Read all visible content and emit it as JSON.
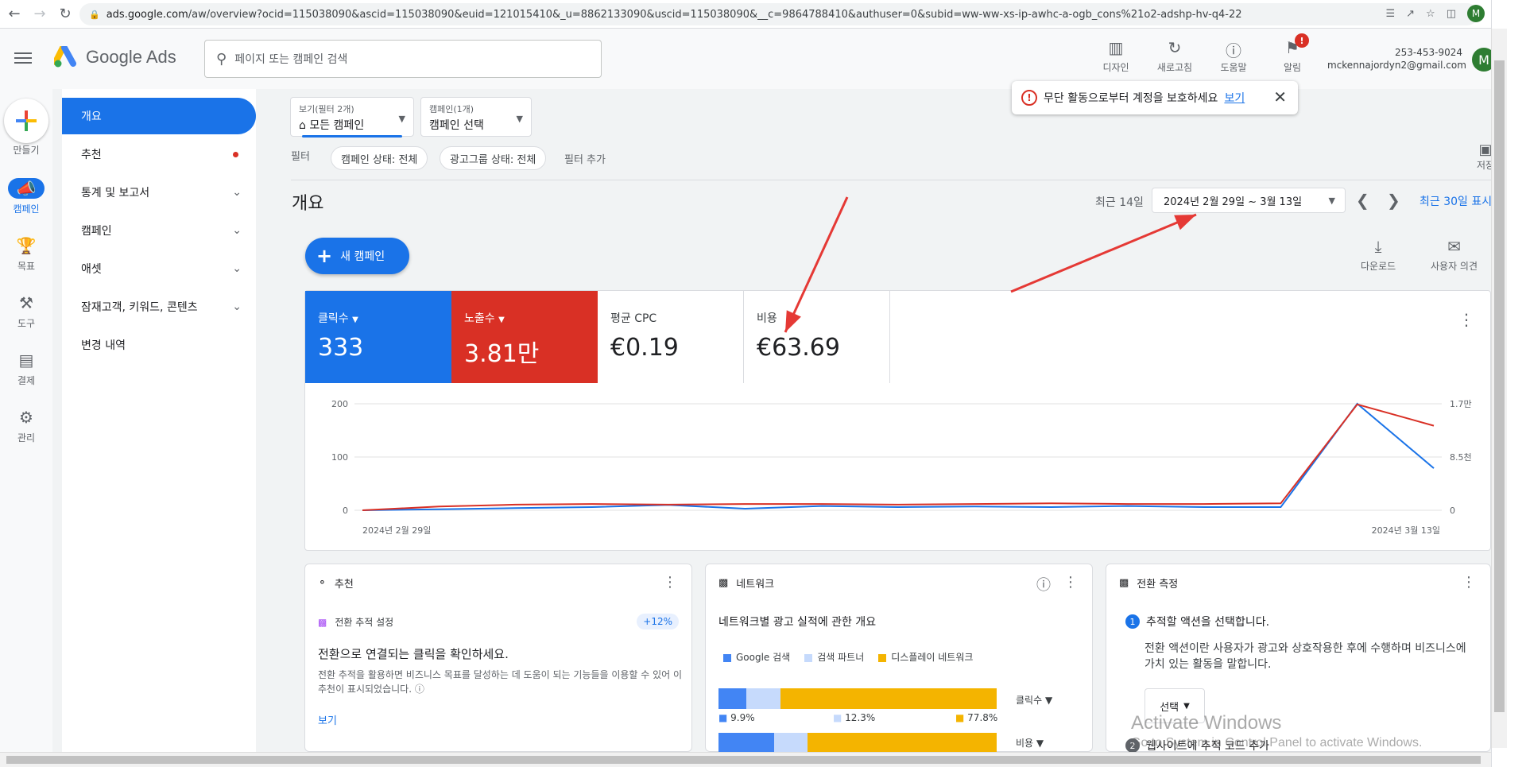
{
  "browser": {
    "url_host": "ads.google.com",
    "url_path": "/aw/overview?ocid=115038090&ascid=115038090&euid=121015410&_u=8862133090&uscid=115038090&__c=9864788410&authuser=0&subid=ww-ww-xs-ip-awhc-a-ogb_cons%21o2-adshp-hv-q4-22",
    "profile_initial": "M"
  },
  "header": {
    "logo_text": "Google Ads",
    "search_placeholder": "페이지 또는 캠페인 검색",
    "tools": [
      {
        "label": "디자인",
        "icon": "design-icon"
      },
      {
        "label": "새로고침",
        "icon": "refresh-icon"
      },
      {
        "label": "도움말",
        "icon": "help-icon"
      },
      {
        "label": "알림",
        "icon": "bell-icon",
        "badge": "!"
      }
    ],
    "account_phone": "253-453-9024",
    "account_email": "mckennajordyn2@gmail.com",
    "account_initial": "M"
  },
  "rail": {
    "create_label": "만들기",
    "items": [
      {
        "label": "캠페인",
        "icon": "megaphone-icon",
        "active": true
      },
      {
        "label": "목표",
        "icon": "trophy-icon"
      },
      {
        "label": "도구",
        "icon": "tools-icon"
      },
      {
        "label": "결제",
        "icon": "card-icon"
      },
      {
        "label": "관리",
        "icon": "gear-icon"
      }
    ]
  },
  "nav": {
    "items": [
      {
        "label": "개요",
        "active": true
      },
      {
        "label": "추천",
        "dot": true
      },
      {
        "label": "통계 및 보고서",
        "expand": true
      },
      {
        "label": "캠페인",
        "expand": true
      },
      {
        "label": "애셋",
        "expand": true
      },
      {
        "label": "잠재고객, 키워드, 콘텐츠",
        "expand": true
      },
      {
        "label": "변경 내역"
      }
    ]
  },
  "filters": {
    "view_small": "보기(필터 2개)",
    "view_value": "모든 캠페인",
    "campaign_small": "캠페인(1개)",
    "campaign_value": "캠페인 선택",
    "filter_label": "필터",
    "chips": [
      "캠페인 상태: 전체",
      "광고그룹 상태: 전체"
    ],
    "add_filter": "필터 추가"
  },
  "alert": {
    "text": "무단 활동으로부터 계정을 보호하세요",
    "link": "보기"
  },
  "save_label": "저장",
  "overview": {
    "title": "개요",
    "date_label": "최근 14일",
    "date_range": "2024년 2월 29일 ~ 3월 13일",
    "recent30": "최근 30일 표시",
    "new_campaign": "새 캠페인",
    "download": "다운로드",
    "feedback": "사용자 의견"
  },
  "metrics": [
    {
      "label": "클릭수",
      "value": "333",
      "style": "blue",
      "dropdown": true
    },
    {
      "label": "노출수",
      "value": "3.81만",
      "style": "red",
      "dropdown": true
    },
    {
      "label": "평균 CPC",
      "value": "€0.19",
      "style": "plain"
    },
    {
      "label": "비용",
      "value": "€63.69",
      "style": "plain"
    }
  ],
  "chart_data": {
    "type": "line",
    "x_start_label": "2024년 2월 29일",
    "x_end_label": "2024년 3월 13일",
    "y_left_ticks": [
      "200",
      "100",
      "0"
    ],
    "y_right_ticks": [
      "1.7만",
      "8.5천",
      "0"
    ],
    "ylim_left": [
      0,
      200
    ],
    "ylim_right": [
      0,
      17000
    ],
    "series": [
      {
        "color": "#1a73e8",
        "axis": "left",
        "values": [
          0,
          2,
          4,
          6,
          10,
          3,
          8,
          6,
          7,
          6,
          8,
          6,
          6,
          200,
          79
        ]
      },
      {
        "color": "#d93025",
        "axis": "right",
        "values": [
          0,
          600,
          900,
          1000,
          900,
          1000,
          1000,
          900,
          1000,
          1100,
          1000,
          1000,
          1100,
          16900,
          13500
        ]
      }
    ]
  },
  "cards": {
    "rec": {
      "title": "추천",
      "sub": "전환 추적 설정",
      "badge": "+12%",
      "headline": "전환으로 연결되는 클릭을 확인하세요.",
      "desc": "전환 추적을 활용하면 비즈니스 목표를 달성하는 데 도움이 되는 기능들을 이용할 수 있어 이 추천이 표시되었습니다.",
      "link": "보기"
    },
    "network": {
      "title": "네트워크",
      "subtitle": "네트워크별 광고 실적에 관한 개요",
      "legend": [
        {
          "name": "Google 검색",
          "color": "#4285f4"
        },
        {
          "name": "검색 파트너",
          "color": "#c6dafc"
        },
        {
          "name": "디스플레이 네트워크",
          "color": "#f4b400"
        }
      ],
      "rows": [
        {
          "metric": "클릭수",
          "pct": [
            9.9,
            12.3,
            77.8
          ],
          "labels": [
            "9.9%",
            "12.3%",
            "77.8%"
          ]
        },
        {
          "metric": "비용",
          "pct": [
            20,
            12,
            68
          ]
        }
      ]
    },
    "conversion": {
      "title": "전환 측정",
      "step1_num": "1",
      "step1": "추적할 액션을 선택합니다.",
      "desc": "전환 액션이란 사용자가 광고와 상호작용한 후에 수행하며 비즈니스에 가치 있는 활동을 말합니다.",
      "select": "선택",
      "step2_num": "2",
      "step2": "웹사이트에 추적 코드 추가"
    }
  },
  "watermark": {
    "line1": "Activate Windows",
    "line2": "Go to System in Control Panel to activate Windows."
  },
  "annotation_color": "#e53935"
}
